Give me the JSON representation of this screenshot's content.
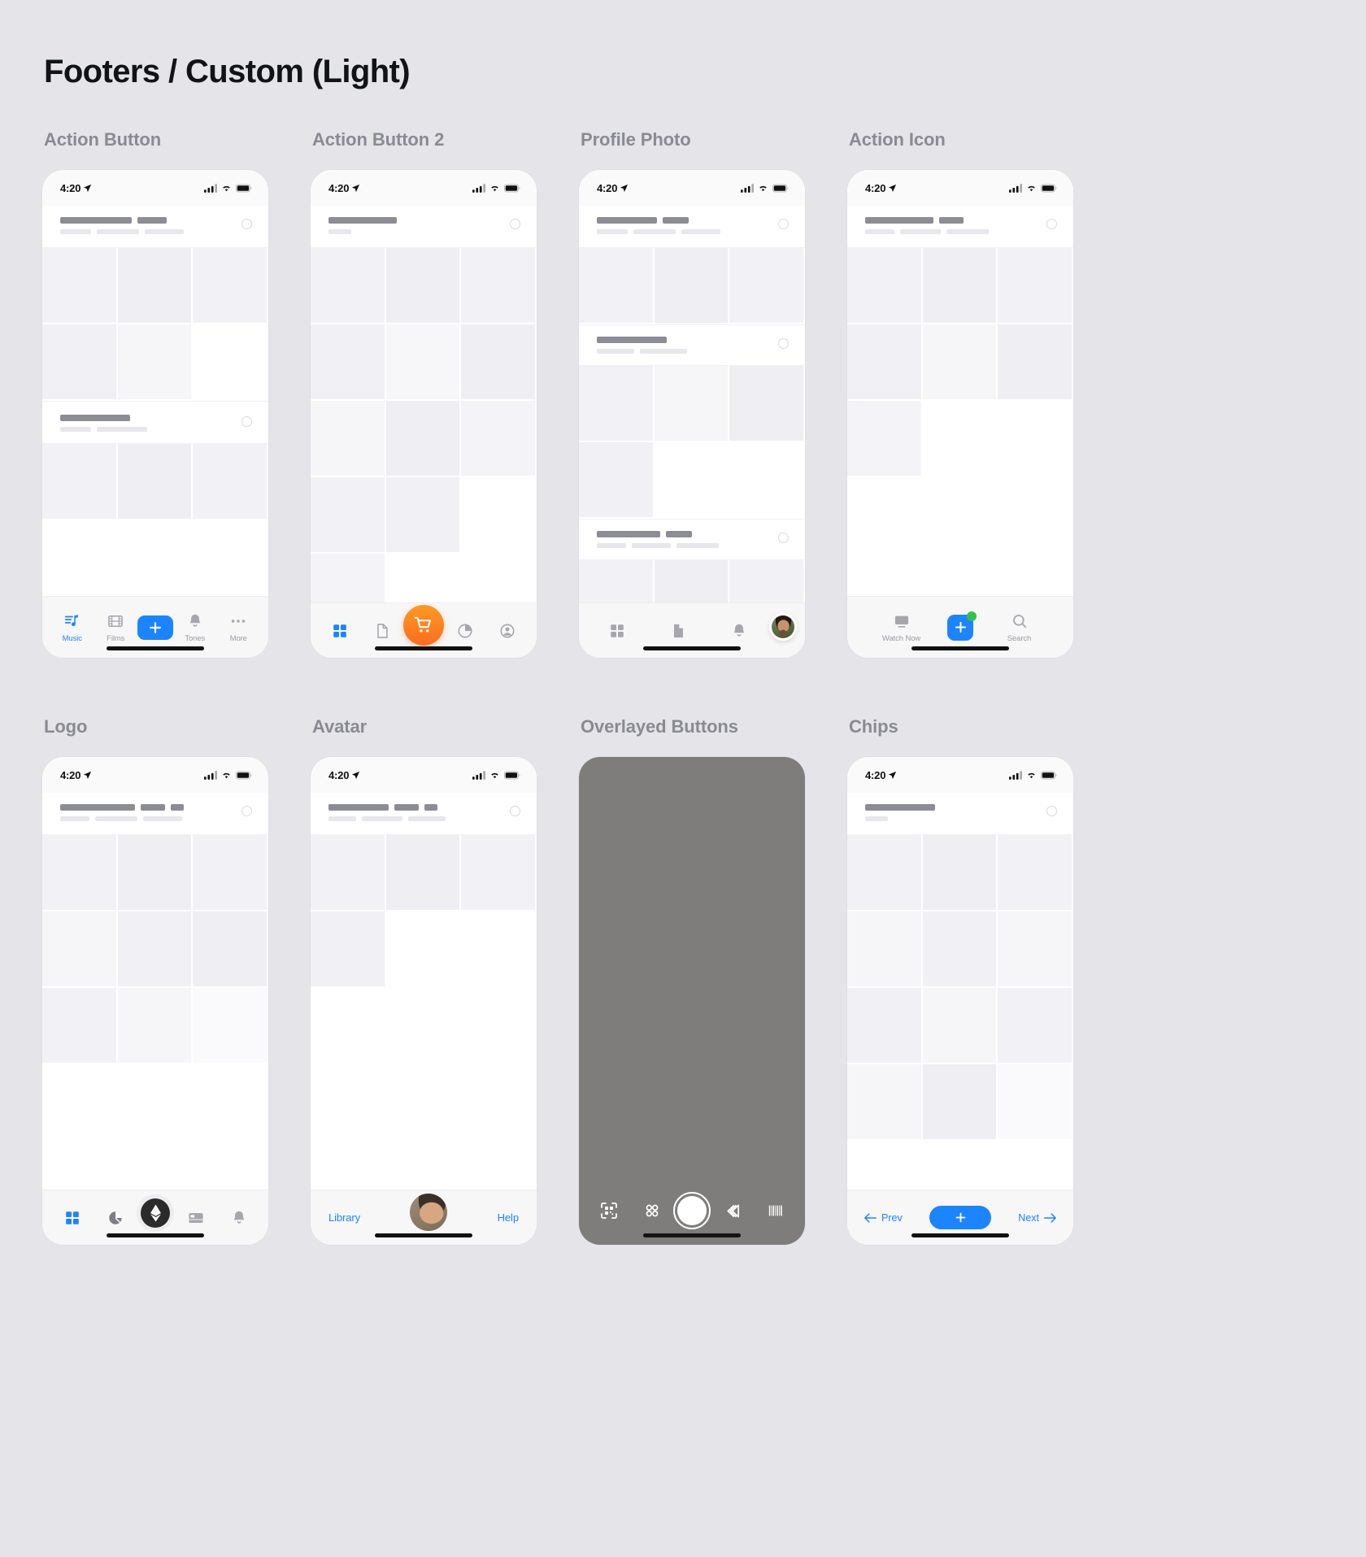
{
  "page": {
    "title": "Footers / Custom (Light)"
  },
  "status_bar": {
    "time": "4:20",
    "location_icon": "location-arrow-icon",
    "signal_icon": "cellular-signal-icon",
    "wifi_icon": "wifi-icon",
    "battery_icon": "battery-icon"
  },
  "colors": {
    "accent_blue": "#1C84FF",
    "accent_orange": "#F96D21",
    "badge_green": "#31C24C",
    "canvas": "#E4E4E9",
    "label_gray": "#8A8A93"
  },
  "sections": [
    {
      "label": "Action Button",
      "footer_type": "tabbar-labeled",
      "items": [
        {
          "name": "music",
          "label": "Music",
          "icon": "music-note-icon",
          "active": true
        },
        {
          "name": "films",
          "label": "Films",
          "icon": "film-strip-icon",
          "active": false
        },
        {
          "name": "add",
          "label": "",
          "icon": "plus-icon",
          "style": "fab-rounded-rect"
        },
        {
          "name": "tones",
          "label": "Tones",
          "icon": "bell-icon",
          "active": false
        },
        {
          "name": "more",
          "label": "More",
          "icon": "ellipsis-icon",
          "active": false
        }
      ]
    },
    {
      "label": "Action Button 2",
      "footer_type": "tabbar-icons",
      "items": [
        {
          "name": "dashboard",
          "label": "",
          "icon": "grid-squares-icon",
          "active": true
        },
        {
          "name": "documents",
          "label": "",
          "icon": "document-icon",
          "active": false
        },
        {
          "name": "cart",
          "label": "",
          "icon": "shopping-cart-icon",
          "style": "fab-circle-orange"
        },
        {
          "name": "analytics",
          "label": "",
          "icon": "pie-chart-icon",
          "active": false
        },
        {
          "name": "account",
          "label": "",
          "icon": "person-circle-icon",
          "active": false
        }
      ]
    },
    {
      "label": "Profile Photo",
      "footer_type": "tabbar-icons",
      "items": [
        {
          "name": "dashboard",
          "label": "",
          "icon": "grid-squares-icon",
          "active": false
        },
        {
          "name": "documents",
          "label": "",
          "icon": "document-icon",
          "active": false
        },
        {
          "name": "notifications",
          "label": "",
          "icon": "bell-icon",
          "active": false
        },
        {
          "name": "profile",
          "label": "",
          "icon": "profile-photo-avatar",
          "style": "avatar-ring"
        }
      ]
    },
    {
      "label": "Action Icon",
      "footer_type": "tabbar-labeled",
      "items": [
        {
          "name": "watch-now",
          "label": "Watch Now",
          "icon": "tv-monitor-icon",
          "active": false
        },
        {
          "name": "add",
          "label": "",
          "icon": "plus-icon",
          "style": "fab-square-badge",
          "badge": "green-dot"
        },
        {
          "name": "search",
          "label": "Search",
          "icon": "magnifier-icon",
          "active": false
        }
      ]
    },
    {
      "label": "Logo",
      "footer_type": "tabbar-icons",
      "items": [
        {
          "name": "dashboard",
          "label": "",
          "icon": "grid-squares-icon",
          "active": true
        },
        {
          "name": "analytics",
          "label": "",
          "icon": "pie-chart-icon",
          "active": false
        },
        {
          "name": "brand-logo",
          "label": "",
          "icon": "ethereum-logo-icon",
          "style": "logo-badge"
        },
        {
          "name": "wallet",
          "label": "",
          "icon": "credit-card-icon",
          "active": false
        },
        {
          "name": "notifications",
          "label": "",
          "icon": "bell-icon",
          "active": false
        }
      ]
    },
    {
      "label": "Avatar",
      "footer_type": "links-avatar",
      "items": [
        {
          "name": "library",
          "label": "Library",
          "icon": "",
          "style": "text-link"
        },
        {
          "name": "avatar",
          "label": "",
          "icon": "user-avatar-photo",
          "style": "avatar-large"
        },
        {
          "name": "help",
          "label": "Help",
          "icon": "",
          "style": "text-link"
        }
      ]
    },
    {
      "label": "Overlayed Buttons",
      "footer_type": "camera-overlay",
      "items": [
        {
          "name": "scan-code",
          "label": "",
          "icon": "qr-scan-icon"
        },
        {
          "name": "filters",
          "label": "",
          "icon": "four-circles-icon"
        },
        {
          "name": "shutter",
          "label": "",
          "icon": "camera-shutter-icon",
          "style": "shutter"
        },
        {
          "name": "layers",
          "label": "",
          "icon": "layers-icon"
        },
        {
          "name": "barcode",
          "label": "",
          "icon": "barcode-icon"
        }
      ]
    },
    {
      "label": "Chips",
      "footer_type": "chips-nav",
      "items": [
        {
          "name": "prev",
          "label": "Prev",
          "icon": "arrow-left-icon",
          "style": "text-link-left"
        },
        {
          "name": "add",
          "label": "",
          "icon": "plus-icon",
          "style": "pill-blue"
        },
        {
          "name": "next",
          "label": "Next",
          "icon": "arrow-right-icon",
          "style": "text-link-right"
        }
      ]
    }
  ]
}
